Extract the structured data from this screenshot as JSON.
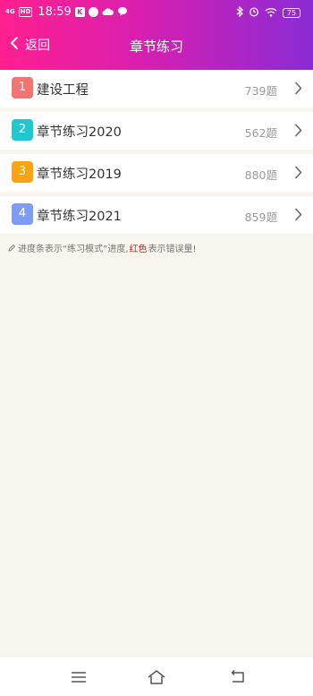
{
  "status_bar": {
    "network": "4G",
    "hd": "HD",
    "time": "18:59",
    "battery": "75"
  },
  "nav": {
    "back_label": "返回",
    "title": "章节练习"
  },
  "chapters": [
    {
      "index": "1",
      "name": "建设工程",
      "count": "739题",
      "color": "#f47474"
    },
    {
      "index": "2",
      "name": "章节练习2020",
      "count": "562题",
      "color": "#1ec8cf"
    },
    {
      "index": "3",
      "name": "章节练习2019",
      "count": "880题",
      "color": "#fba312"
    },
    {
      "index": "4",
      "name": "章节练习2021",
      "count": "859题",
      "color": "#7f9cf5"
    }
  ],
  "note": {
    "part1": "进度条表示“练习模式”进度,",
    "highlight": "红色",
    "part2": "表示错误量!"
  },
  "colors": {
    "header_gradient_start": "#ff1f8f",
    "header_gradient_end": "#8a2bd6",
    "background": "#f8f5ee",
    "highlight_red": "#d0241a"
  }
}
